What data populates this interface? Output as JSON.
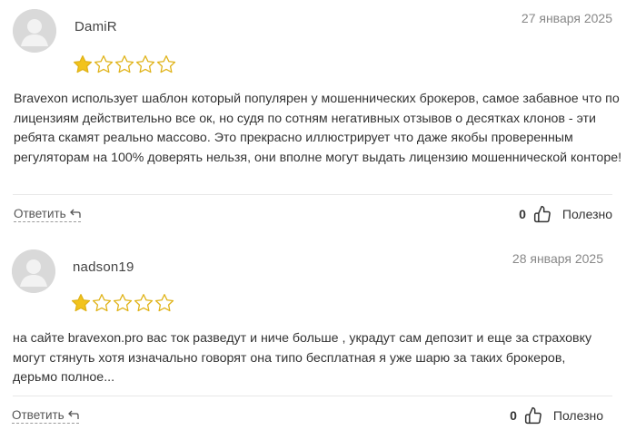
{
  "reviews": [
    {
      "author": "DamiR",
      "date": "27 января 2025",
      "rating": 1,
      "text": "Bravexon использует шаблон который популярен у мошеннических брокеров, самое забавное что по лицензиям действительно все ок, но судя по сотням негативных отзывов о десятках клонов - эти ребята скамят реально массово. Это прекрасно иллюстрирует что даже якобы проверенным регуляторам на 100% доверять нельзя, они вполне могут выдать лицензию мошеннической конторе!",
      "reply_label": "Ответить",
      "likes": "0",
      "useful_label": "Полезно"
    },
    {
      "author": "nadson19",
      "date": "28 января 2025",
      "rating": 1,
      "text": "на сайте bravexon.pro вас ток разведут и ниче больше , украдут сам депозит и еще за страховку могут стянуть хотя изначально говорят она типо бесплатная я уже шарю за таких брокеров, дерьмо полное...",
      "reply_label": "Ответить",
      "likes": "0",
      "useful_label": "Полезно"
    }
  ],
  "colors": {
    "star_filled": "#f2c31b",
    "star_outline": "#e0b319",
    "avatar_bg": "#d9d9d9",
    "avatar_fg": "#f2f2f2"
  },
  "icons": {
    "avatar": "user-silhouette-icon",
    "star": "star-icon",
    "reply": "reply-arrow-icon",
    "like": "thumbs-up-icon"
  }
}
